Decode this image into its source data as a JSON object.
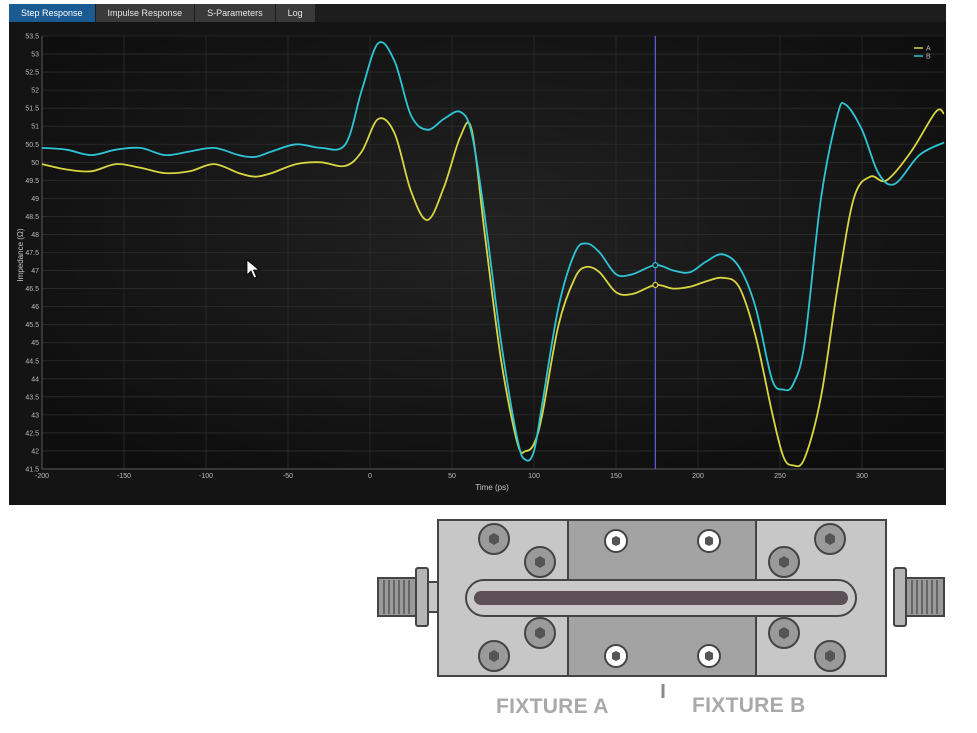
{
  "tabs": [
    {
      "label": "Step Response",
      "active": true
    },
    {
      "label": "Impulse Response",
      "active": false
    },
    {
      "label": "S-Parameters",
      "active": false
    },
    {
      "label": "Log",
      "active": false
    }
  ],
  "chart_data": {
    "type": "line",
    "xlabel": "Time (ps)",
    "ylabel": "Impedance (Ω)",
    "xlim": [
      -200,
      350
    ],
    "ylim": [
      41.5,
      53.5
    ],
    "xticks": [
      -200,
      -150,
      -100,
      -50,
      0,
      50,
      100,
      150,
      200,
      250,
      300
    ],
    "yticks": [
      41.5,
      42,
      42.5,
      43,
      43.5,
      44,
      44.5,
      45,
      45.5,
      46,
      46.5,
      47,
      47.5,
      48,
      48.5,
      49,
      49.5,
      50,
      50.5,
      51,
      51.5,
      52,
      52.5,
      53,
      53.5
    ],
    "grid": true,
    "legend": "top-right",
    "cursor_x": 174,
    "series": [
      {
        "name": "A",
        "color": "#d8d640",
        "x": [
          -200,
          -185,
          -170,
          -155,
          -140,
          -125,
          -110,
          -95,
          -80,
          -70,
          -60,
          -45,
          -30,
          -15,
          -5,
          5,
          15,
          25,
          35,
          45,
          55,
          62,
          70,
          80,
          90,
          95,
          100,
          105,
          115,
          125,
          132,
          140,
          150,
          160,
          174,
          185,
          195,
          205,
          215,
          225,
          235,
          245,
          252,
          258,
          265,
          275,
          285,
          295,
          305,
          315,
          330,
          345,
          350
        ],
        "y": [
          49.95,
          49.8,
          49.75,
          49.95,
          49.85,
          49.7,
          49.75,
          49.95,
          49.7,
          49.6,
          49.7,
          49.95,
          50.0,
          49.9,
          50.3,
          51.2,
          50.8,
          49.2,
          48.4,
          49.3,
          50.7,
          50.9,
          48.0,
          44.5,
          42.2,
          42.0,
          42.2,
          43.0,
          45.5,
          46.8,
          47.1,
          46.95,
          46.4,
          46.35,
          46.6,
          46.5,
          46.55,
          46.7,
          46.8,
          46.55,
          45.2,
          43.1,
          41.85,
          41.6,
          41.8,
          43.5,
          46.5,
          49.0,
          49.6,
          49.5,
          50.3,
          51.4,
          51.35
        ]
      },
      {
        "name": "B",
        "color": "#2ec4d4",
        "x": [
          -200,
          -185,
          -170,
          -155,
          -140,
          -125,
          -110,
          -95,
          -80,
          -70,
          -60,
          -45,
          -30,
          -15,
          -5,
          5,
          15,
          25,
          35,
          45,
          55,
          62,
          70,
          80,
          90,
          95,
          100,
          105,
          115,
          125,
          132,
          140,
          150,
          160,
          174,
          185,
          195,
          205,
          215,
          225,
          235,
          245,
          252,
          258,
          265,
          275,
          285,
          290,
          300,
          310,
          320,
          335,
          350
        ],
        "y": [
          50.4,
          50.35,
          50.2,
          50.35,
          50.4,
          50.2,
          50.3,
          50.4,
          50.2,
          50.15,
          50.3,
          50.5,
          50.4,
          50.5,
          52.0,
          53.3,
          52.8,
          51.3,
          50.9,
          51.2,
          51.4,
          50.8,
          48.5,
          45.0,
          42.3,
          41.75,
          42.0,
          43.3,
          46.0,
          47.5,
          47.75,
          47.5,
          46.9,
          46.9,
          47.15,
          47.0,
          46.95,
          47.25,
          47.45,
          47.1,
          46.0,
          44.0,
          43.7,
          43.85,
          45.0,
          49.0,
          51.3,
          51.6,
          50.9,
          49.7,
          49.4,
          50.2,
          50.55
        ]
      }
    ],
    "legend_labels": [
      "A",
      "B"
    ]
  },
  "fixture": {
    "label_a": "FIXTURE A",
    "label_b": "FIXTURE B"
  }
}
